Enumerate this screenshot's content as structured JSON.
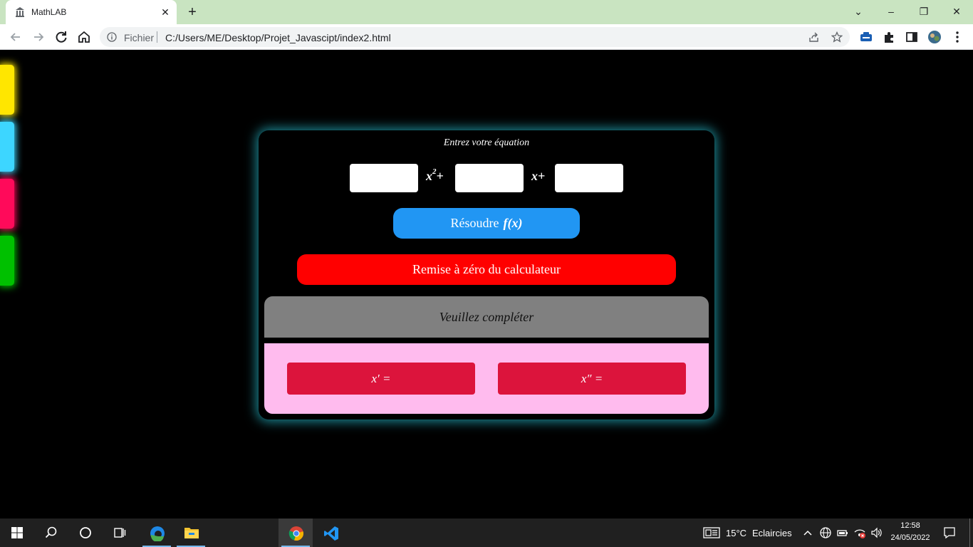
{
  "browser": {
    "tab_title": "MathLAB",
    "tab_close_label": "✕",
    "new_tab_label": "+",
    "window_controls": {
      "dropdown": "⌄",
      "minimize": "–",
      "restore": "❐",
      "close": "✕"
    },
    "address_scheme": "Fichier",
    "address_url": "C:/Users/ME/Desktop/Projet_Javascipt/index2.html"
  },
  "side_tabs": {
    "colors": [
      "#ffe600",
      "#3dd6ff",
      "#ff0a5a",
      "#00c000"
    ]
  },
  "calculator": {
    "title": "Entrez votre équation",
    "term_x2_base": "x",
    "term_x2_exp": "2",
    "term_x2_plus": "+",
    "term_x": "x+",
    "inputs": [
      {
        "value": "",
        "placeholder": ""
      },
      {
        "value": "",
        "placeholder": ""
      },
      {
        "value": "",
        "placeholder": ""
      }
    ],
    "solve_label": "Résoudre",
    "solve_fx": "f(x)",
    "reset_label": "Remise à zéro du calculateur",
    "status_text": "Veuillez compléter",
    "root1_label": "x′ =",
    "root2_label": "x″ ="
  },
  "colors": {
    "solve": "#2196f3",
    "reset": "#ff0000",
    "status_bg": "#808080",
    "results_bg": "#ffbbee",
    "root_bg": "#dc143c",
    "card_glow": "#26b4c4"
  },
  "taskbar": {
    "weather_temp": "15°C",
    "weather_desc": "Eclaircies",
    "time": "12:58",
    "date": "24/05/2022"
  }
}
